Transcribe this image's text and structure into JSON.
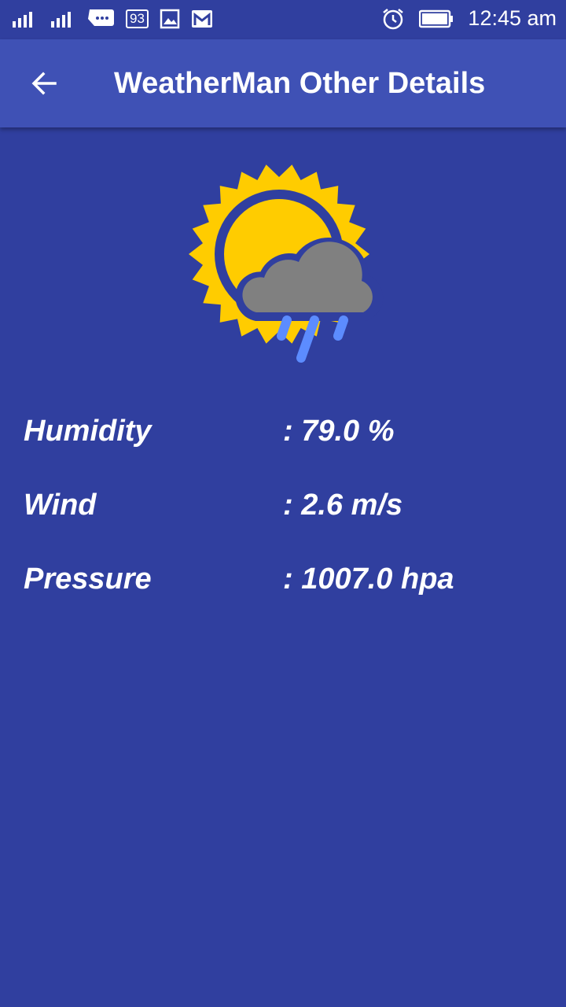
{
  "status_bar": {
    "battery_percent": "93",
    "time": "12:45 am"
  },
  "app_bar": {
    "title": "WeatherMan Other Details"
  },
  "weather": {
    "icon": "partly-cloudy-rain-icon"
  },
  "details": [
    {
      "label": "Humidity",
      "value": ": 79.0 %"
    },
    {
      "label": "Wind",
      "value": ": 2.6 m/s"
    },
    {
      "label": "Pressure",
      "value": ": 1007.0 hpa"
    }
  ],
  "colors": {
    "background": "#303f9f",
    "app_bar": "#3f51b5",
    "sun": "#ffcc00",
    "cloud": "#808080",
    "rain": "#5c8cff"
  }
}
